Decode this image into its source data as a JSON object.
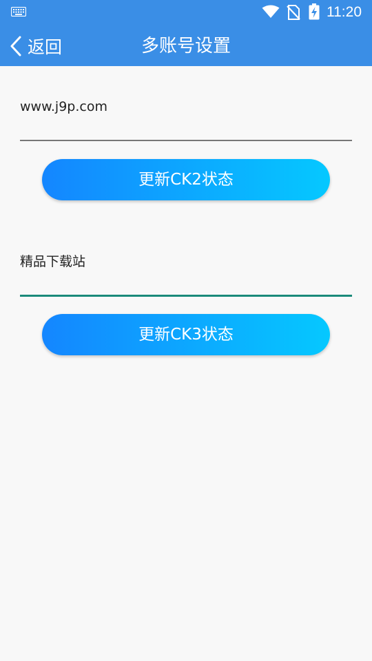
{
  "status_bar": {
    "time": "11:20",
    "icons": [
      "keyboard-icon",
      "wifi-icon",
      "no-sim-icon",
      "battery-charging-icon"
    ]
  },
  "header": {
    "back_label": "返回",
    "title": "多账号设置"
  },
  "accounts": [
    {
      "field_value": "www.j9p.com",
      "button_label": "更新CK2状态",
      "focused": false
    },
    {
      "field_value": "精品下载站",
      "button_label": "更新CK3状态",
      "focused": true
    }
  ],
  "colors": {
    "header_bg": "#3a8ee6",
    "page_bg": "#f8f8f8",
    "button_gradient_start": "#1486ff",
    "button_gradient_end": "#05c8ff",
    "underline_default": "#777777",
    "underline_focused": "#1a8a7a"
  }
}
